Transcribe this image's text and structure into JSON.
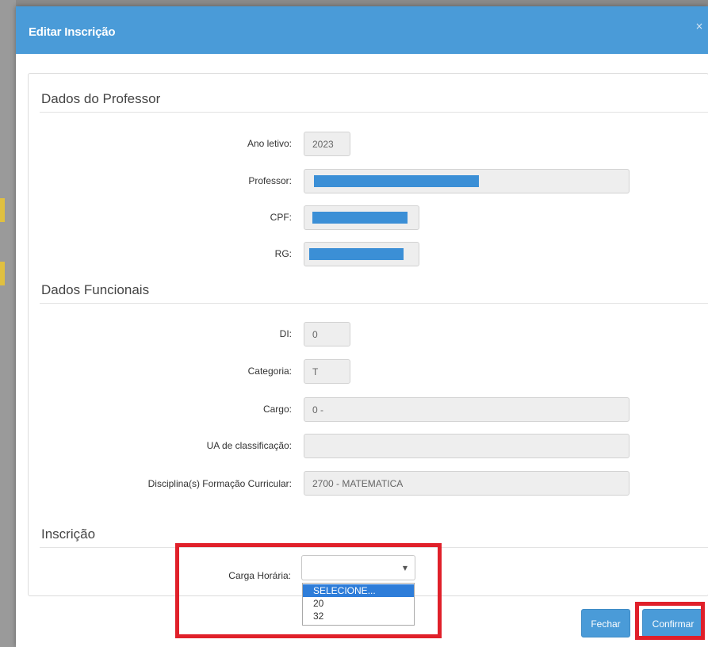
{
  "modal": {
    "title": "Editar Inscrição",
    "close": "×"
  },
  "sections": {
    "professor": "Dados do Professor",
    "funcionais": "Dados Funcionais",
    "inscricao": "Inscrição"
  },
  "professor": {
    "ano_letivo_label": "Ano letivo:",
    "ano_letivo_value": "2023",
    "professor_label": "Professor:",
    "cpf_label": "CPF:",
    "rg_label": "RG:"
  },
  "funcionais": {
    "di_label": "DI:",
    "di_value": "0",
    "categoria_label": "Categoria:",
    "categoria_value": "T",
    "cargo_label": "Cargo:",
    "cargo_value": "0 -",
    "ua_label": "UA de classificação:",
    "ua_value": "",
    "disciplina_label": "Disciplina(s) Formação Curricular:",
    "disciplina_value": "2700 - MATEMATICA"
  },
  "inscricao": {
    "carga_label": "Carga Horária:",
    "carga_value": "",
    "options": [
      "SELECIONE...",
      "20",
      "32"
    ],
    "selected_option": "SELECIONE..."
  },
  "footer": {
    "fechar": "Fechar",
    "confirmar": "Confirmar"
  },
  "icons": {
    "caret": "caret-down-icon"
  },
  "colors": {
    "header": "#4a9bd8",
    "highlight": "#e0202a",
    "option_selected": "#2e7dd9",
    "redaction": "#3b8fd6"
  }
}
